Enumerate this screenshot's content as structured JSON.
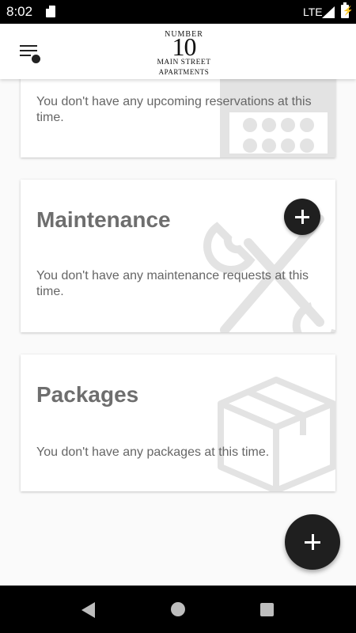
{
  "status_bar": {
    "time": "8:02",
    "network": "LTE",
    "icons": [
      "sd-card-icon",
      "signal-icon",
      "battery-charging-icon"
    ]
  },
  "header": {
    "menu_icon": "menu-icon",
    "logo": {
      "line1": "NUMBER",
      "number": "10",
      "line2": "MAIN STREET",
      "line3": "APARTMENTS"
    }
  },
  "cards": {
    "reservations": {
      "text": "You don't have any upcoming reservations at this time.",
      "icon": "calendar-icon"
    },
    "maintenance": {
      "title": "Maintenance",
      "text": "You don't have any maintenance requests at this time.",
      "icon": "tools-icon",
      "action_icon": "plus-icon"
    },
    "packages": {
      "title": "Packages",
      "text": "You don't have any packages at this time.",
      "icon": "box-icon"
    }
  },
  "fab": {
    "icon": "plus-icon"
  },
  "nav_bar": {
    "icons": [
      "back-icon",
      "home-icon",
      "recents-icon"
    ]
  },
  "colors": {
    "accent": "#1f1f1f",
    "title_text": "#6e6e6e",
    "body_text": "#666666",
    "watermark": "#e3e3e3"
  }
}
